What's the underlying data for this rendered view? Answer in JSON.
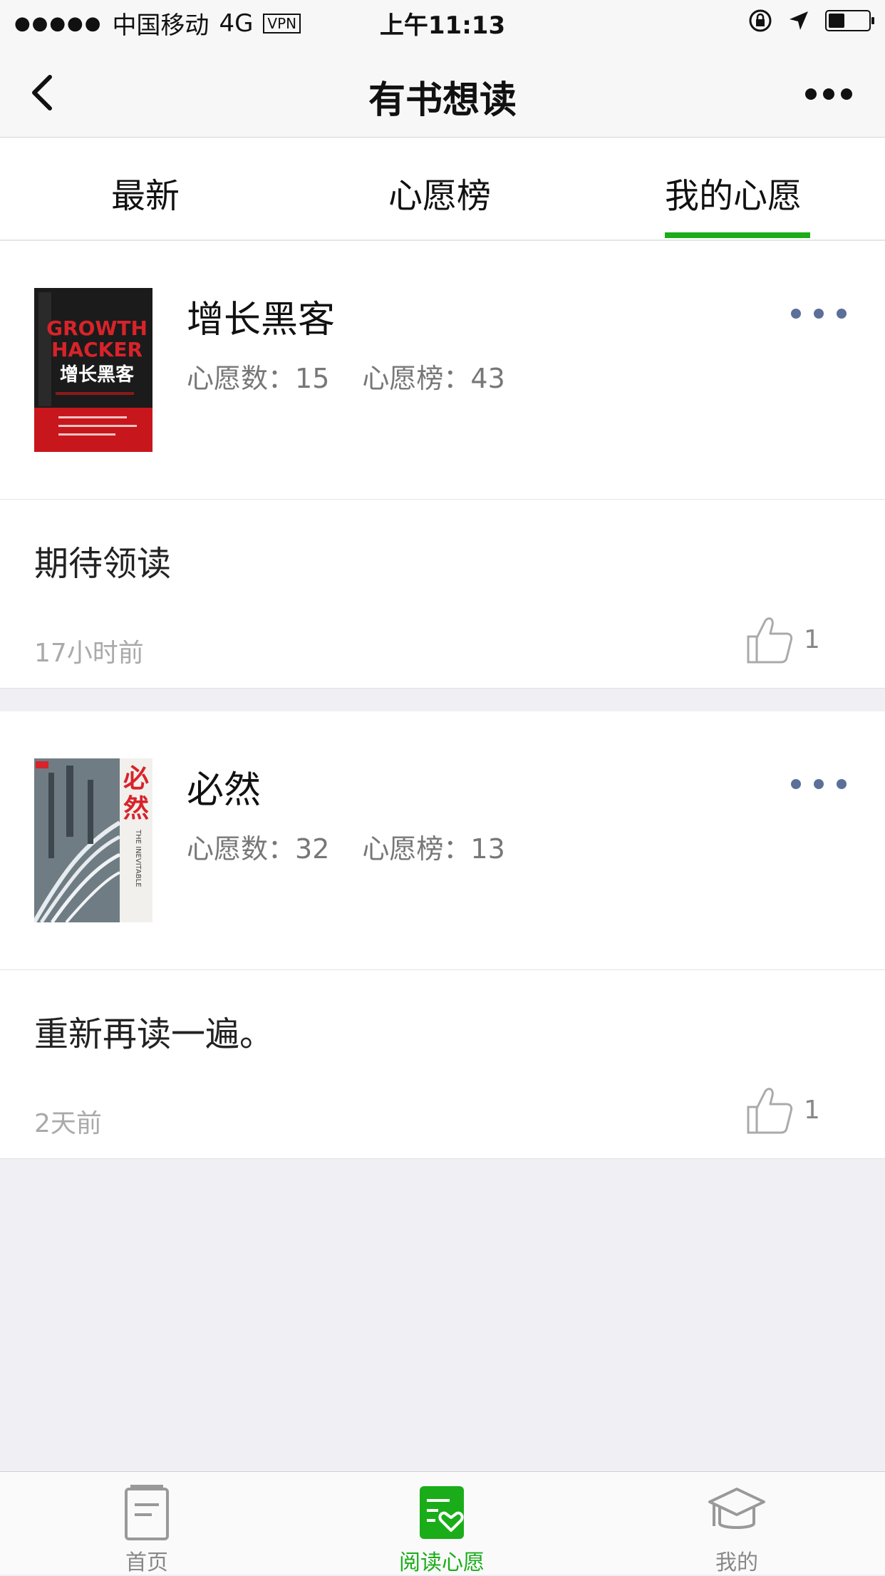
{
  "status_bar": {
    "signal": "●●●●●",
    "carrier": "中国移动",
    "network": "4G",
    "vpn": "VPN",
    "time": "上午11:13"
  },
  "nav": {
    "title": "有书想读"
  },
  "tabs": [
    {
      "label": "最新",
      "active": false
    },
    {
      "label": "心愿榜",
      "active": false
    },
    {
      "label": "我的心愿",
      "active": true
    }
  ],
  "wishes": [
    {
      "book_title": "增长黑客",
      "cover_text": [
        "GROWTH",
        "HACKER",
        "增长黑客"
      ],
      "wish_label": "心愿数：",
      "wish_count": "15",
      "rank_label": "心愿榜：",
      "rank": "43",
      "comment": "期待领读",
      "time": "17小时前",
      "likes": "1"
    },
    {
      "book_title": "必然",
      "cover_text": [
        "必",
        "然",
        "THE INEVITABLE"
      ],
      "wish_label": "心愿数：",
      "wish_count": "32",
      "rank_label": "心愿榜：",
      "rank": "13",
      "comment": "重新再读一遍。",
      "time": "2天前",
      "likes": "1"
    }
  ],
  "tabbar": [
    {
      "label": "首页",
      "icon": "home-notebook-icon",
      "active": false
    },
    {
      "label": "阅读心愿",
      "icon": "reading-wish-icon",
      "active": true
    },
    {
      "label": "我的",
      "icon": "graduation-cap-icon",
      "active": false
    }
  ],
  "colors": {
    "accent": "#1aad19",
    "background": "#efeff4",
    "dots": "#5b6f99"
  }
}
